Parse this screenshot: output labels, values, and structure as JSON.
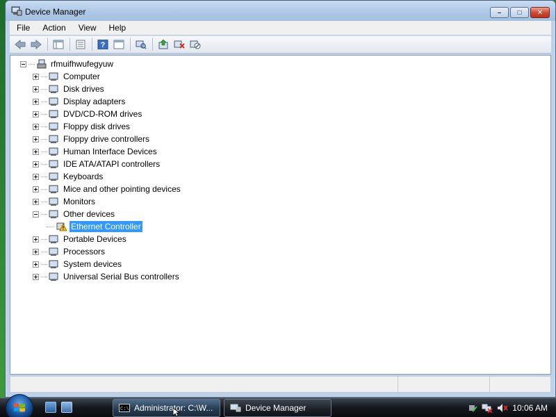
{
  "window": {
    "title": "Device Manager",
    "controls": {
      "minimize": "–",
      "maximize": "□",
      "close": "✕"
    }
  },
  "menu": [
    "File",
    "Action",
    "View",
    "Help"
  ],
  "toolbar": {
    "buttons": [
      "back-icon",
      "forward-icon",
      "show-hide-tree-icon",
      "properties-icon",
      "help-icon",
      "view-icon",
      "scan-hardware-icon",
      "update-driver-icon",
      "uninstall-icon",
      "disable-icon"
    ]
  },
  "tree": {
    "root": "rfmuifhwufegyuw",
    "categories": [
      "Computer",
      "Disk drives",
      "Display adapters",
      "DVD/CD-ROM drives",
      "Floppy disk drives",
      "Floppy drive controllers",
      "Human Interface Devices",
      "IDE ATA/ATAPI controllers",
      "Keyboards",
      "Mice and other pointing devices",
      "Monitors",
      "Other devices",
      "Portable Devices",
      "Processors",
      "System devices",
      "Universal Serial Bus controllers"
    ],
    "expanded_category": "Other devices",
    "child_of_other_devices": "Ethernet Controller",
    "selected": "Ethernet Controller"
  },
  "taskbar": {
    "tasks": [
      "Administrator: C:\\W...",
      "Device Manager"
    ],
    "clock": "10:06 AM"
  }
}
